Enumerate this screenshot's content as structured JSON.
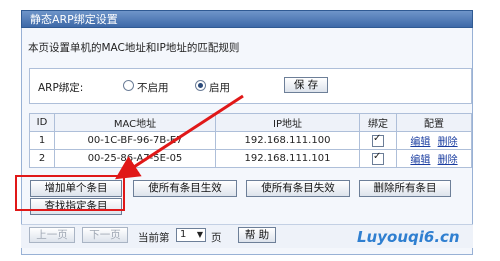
{
  "title": "静态ARP绑定设置",
  "description": "本页设置单机的MAC地址和IP地址的匹配规则",
  "arp": {
    "label": "ARP绑定:",
    "option_off": "不启用",
    "option_on": "启用",
    "selected": "启用",
    "save_label": "保 存"
  },
  "table": {
    "headers": [
      "ID",
      "MAC地址",
      "IP地址",
      "绑定",
      "配置"
    ],
    "rows": [
      {
        "id": "1",
        "mac": "00-1C-BF-96-7B-E7",
        "ip": "192.168.111.100",
        "bound": true,
        "edit": "编辑",
        "delete": "删除"
      },
      {
        "id": "2",
        "mac": "00-25-86-A7-5E-05",
        "ip": "192.168.111.101",
        "bound": true,
        "edit": "编辑",
        "delete": "删除"
      }
    ]
  },
  "actions": {
    "add_single": "增加单个条目",
    "enable_all": "使所有条目生效",
    "disable_all": "使所有条目失效",
    "delete_all": "删除所有条目",
    "find": "查找指定条目"
  },
  "pagination": {
    "prev": "上一页",
    "next": "下一页",
    "current_prefix": "当前第",
    "page_value": "1",
    "page_suffix": "页",
    "help": "帮 助"
  },
  "annotation_color": "#e01818",
  "watermark_text": "Luyouqi6.cn"
}
